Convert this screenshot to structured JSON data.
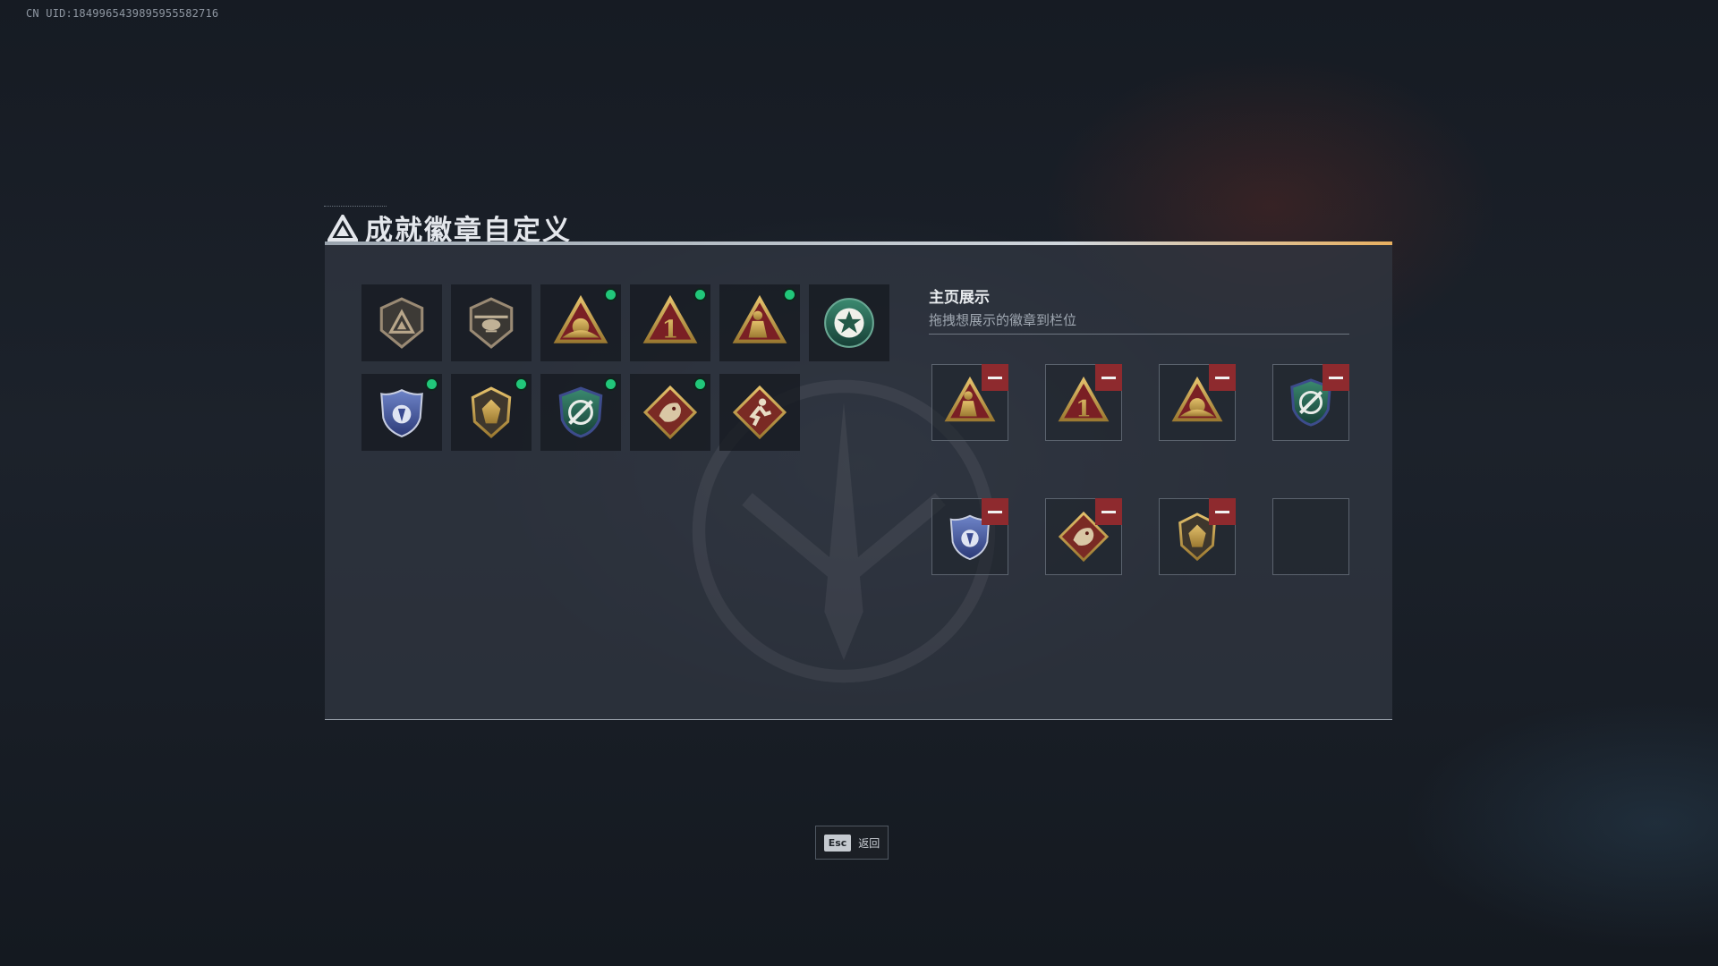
{
  "header": {
    "uid": "CN UID:1849965439895955582716"
  },
  "title": {
    "text": "成就徽章自定义"
  },
  "badge_grid": [
    {
      "icon": "triangle-shield-badge-icon",
      "new": false
    },
    {
      "icon": "helicopter-shield-badge-icon",
      "new": false
    },
    {
      "icon": "mountain-sunrise-badge-icon",
      "new": true
    },
    {
      "icon": "number-one-triangle-badge-icon",
      "new": true
    },
    {
      "icon": "figure-triangle-badge-icon",
      "new": true
    },
    {
      "icon": "green-star-medal-icon",
      "new": false
    },
    {
      "icon": "blue-police-shield-icon",
      "new": true
    },
    {
      "icon": "bronze-crest-badge-icon",
      "new": true
    },
    {
      "icon": "green-wrench-shield-icon",
      "new": true
    },
    {
      "icon": "dragon-diamond-badge-icon",
      "new": true
    },
    {
      "icon": "runner-diamond-badge-icon",
      "new": false
    }
  ],
  "showcase": {
    "title": "主页展示",
    "subtitle": "拖拽想展示的徽章到栏位",
    "slots": [
      {
        "icon": "figure-triangle-badge-icon"
      },
      {
        "icon": "number-one-triangle-badge-icon"
      },
      {
        "icon": "mountain-sunrise-badge-icon"
      },
      {
        "icon": "green-wrench-shield-icon"
      },
      {
        "icon": "blue-police-shield-icon"
      },
      {
        "icon": "dragon-diamond-badge-icon"
      },
      {
        "icon": "bronze-crest-badge-icon"
      },
      {
        "icon": ""
      }
    ]
  },
  "footer": {
    "esc_key": "Esc",
    "esc_label": "返回"
  },
  "colors": {
    "new_dot": "#21c77a",
    "remove": "#8e2a2e",
    "gold": "#c9a24a",
    "maroon": "#7a1f24"
  }
}
